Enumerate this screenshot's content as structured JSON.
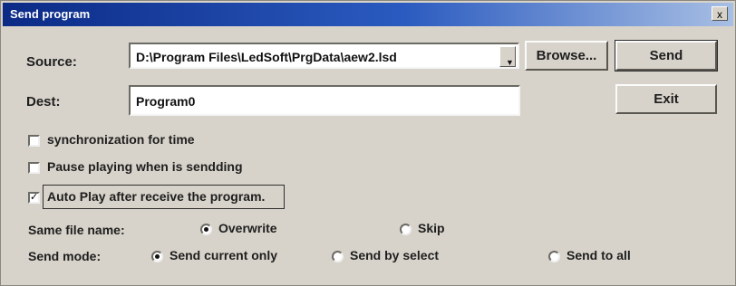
{
  "dialog": {
    "title": "Send program",
    "close_label": "x"
  },
  "source": {
    "label": "Source:",
    "value": "D:\\Program Files\\LedSoft\\PrgData\\aew2.lsd",
    "dropdown_glyph": "▼"
  },
  "dest": {
    "label": "Dest:",
    "value": "Program0"
  },
  "buttons": {
    "browse": "Browse...",
    "send": "Send",
    "exit": "Exit"
  },
  "checkboxes": {
    "sync": {
      "label": "synchronization for time",
      "checked": false
    },
    "pause": {
      "label": "Pause playing when is sendding",
      "checked": false
    },
    "autoplay": {
      "label": "Auto Play after receive the program.",
      "checked": true,
      "check_glyph": "✓"
    }
  },
  "same_file": {
    "label": "Same file name:",
    "options": [
      {
        "label": "Overwrite",
        "selected": true
      },
      {
        "label": "Skip",
        "selected": false
      }
    ]
  },
  "send_mode": {
    "label": "Send mode:",
    "options": [
      {
        "label": "Send current only",
        "selected": true
      },
      {
        "label": "Send by select",
        "selected": false
      },
      {
        "label": "Send to all",
        "selected": false
      }
    ]
  }
}
